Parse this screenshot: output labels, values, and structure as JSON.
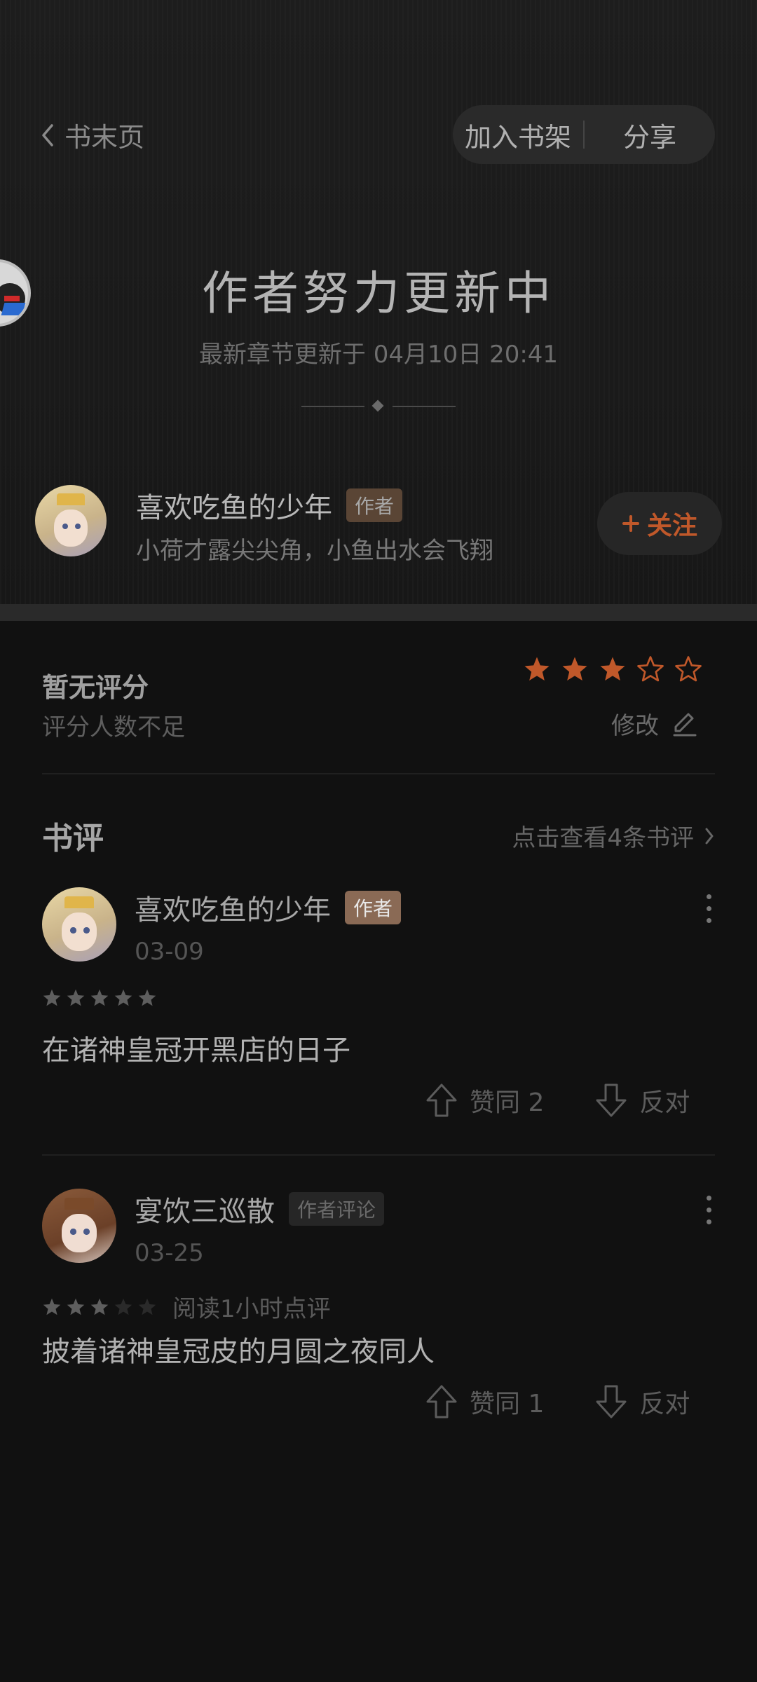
{
  "header": {
    "back_label": "书末页",
    "add_shelf": "加入书架",
    "share": "分享"
  },
  "status": {
    "title": "作者努力更新中",
    "update_text": "最新章节更新于 04月10日 20:41"
  },
  "author": {
    "name": "喜欢吃鱼的少年",
    "tag": "作者",
    "signature": "小荷才露尖尖角，小鱼出水会飞翔",
    "follow_label": "关注"
  },
  "rating": {
    "title": "暂无评分",
    "subtitle": "评分人数不足",
    "my_stars": 3,
    "max_stars": 5,
    "edit_label": "修改"
  },
  "reviews_section": {
    "title": "书评",
    "link_label": "点击查看4条书评",
    "items": [
      {
        "user": "喜欢吃鱼的少年",
        "tag": "作者",
        "date": "03-09",
        "stars": 5,
        "note": "",
        "text": "在诸神皇冠开黑店的日子",
        "up_label": "赞同 2",
        "down_label": "反对"
      },
      {
        "user": "宴饮三巡散",
        "tag": "作者评论",
        "date": "03-25",
        "stars": 3,
        "note": "阅读1小时点评",
        "text": "披着诸神皇冠皮的月圆之夜同人",
        "up_label": "赞同 1",
        "down_label": "反对"
      }
    ]
  },
  "colors": {
    "accent": "#c0582a",
    "background": "#111111"
  }
}
